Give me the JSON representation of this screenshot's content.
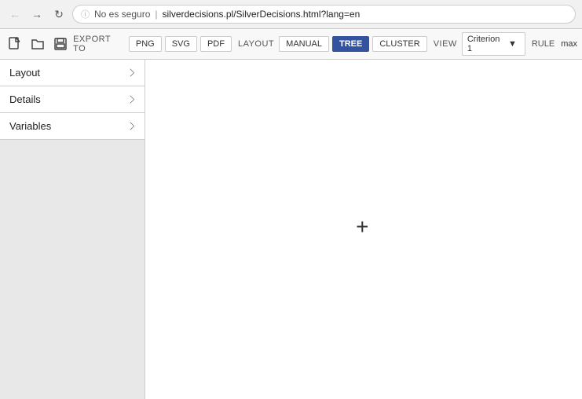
{
  "browser": {
    "back_btn": "←",
    "forward_btn": "→",
    "reload_btn": "↻",
    "insecure_label": "No es seguro",
    "url": "silverdecisions.pl/SilverDecisions.html?lang=en"
  },
  "toolbar": {
    "export_label": "EXPORT TO",
    "png_label": "PNG",
    "svg_label": "SVG",
    "pdf_label": "PDF",
    "layout_label": "LAYOUT",
    "manual_label": "MANUAL",
    "tree_label": "TREE",
    "cluster_label": "CLUSTER",
    "view_label": "VIEW",
    "criterion_label": "Criterion 1",
    "rule_label": "RULE",
    "rule_value": "max"
  },
  "sidebar": {
    "items": [
      {
        "label": "Layout",
        "id": "layout"
      },
      {
        "label": "Details",
        "id": "details"
      },
      {
        "label": "Variables",
        "id": "variables"
      }
    ]
  },
  "canvas": {
    "plus_symbol": "+"
  },
  "icons": {
    "new_file": "🗋",
    "open_file": "📂",
    "save_file": "💾",
    "chevron_down": "▾",
    "back": "←",
    "forward": "→",
    "reload": "↻",
    "lock": "⚠"
  }
}
